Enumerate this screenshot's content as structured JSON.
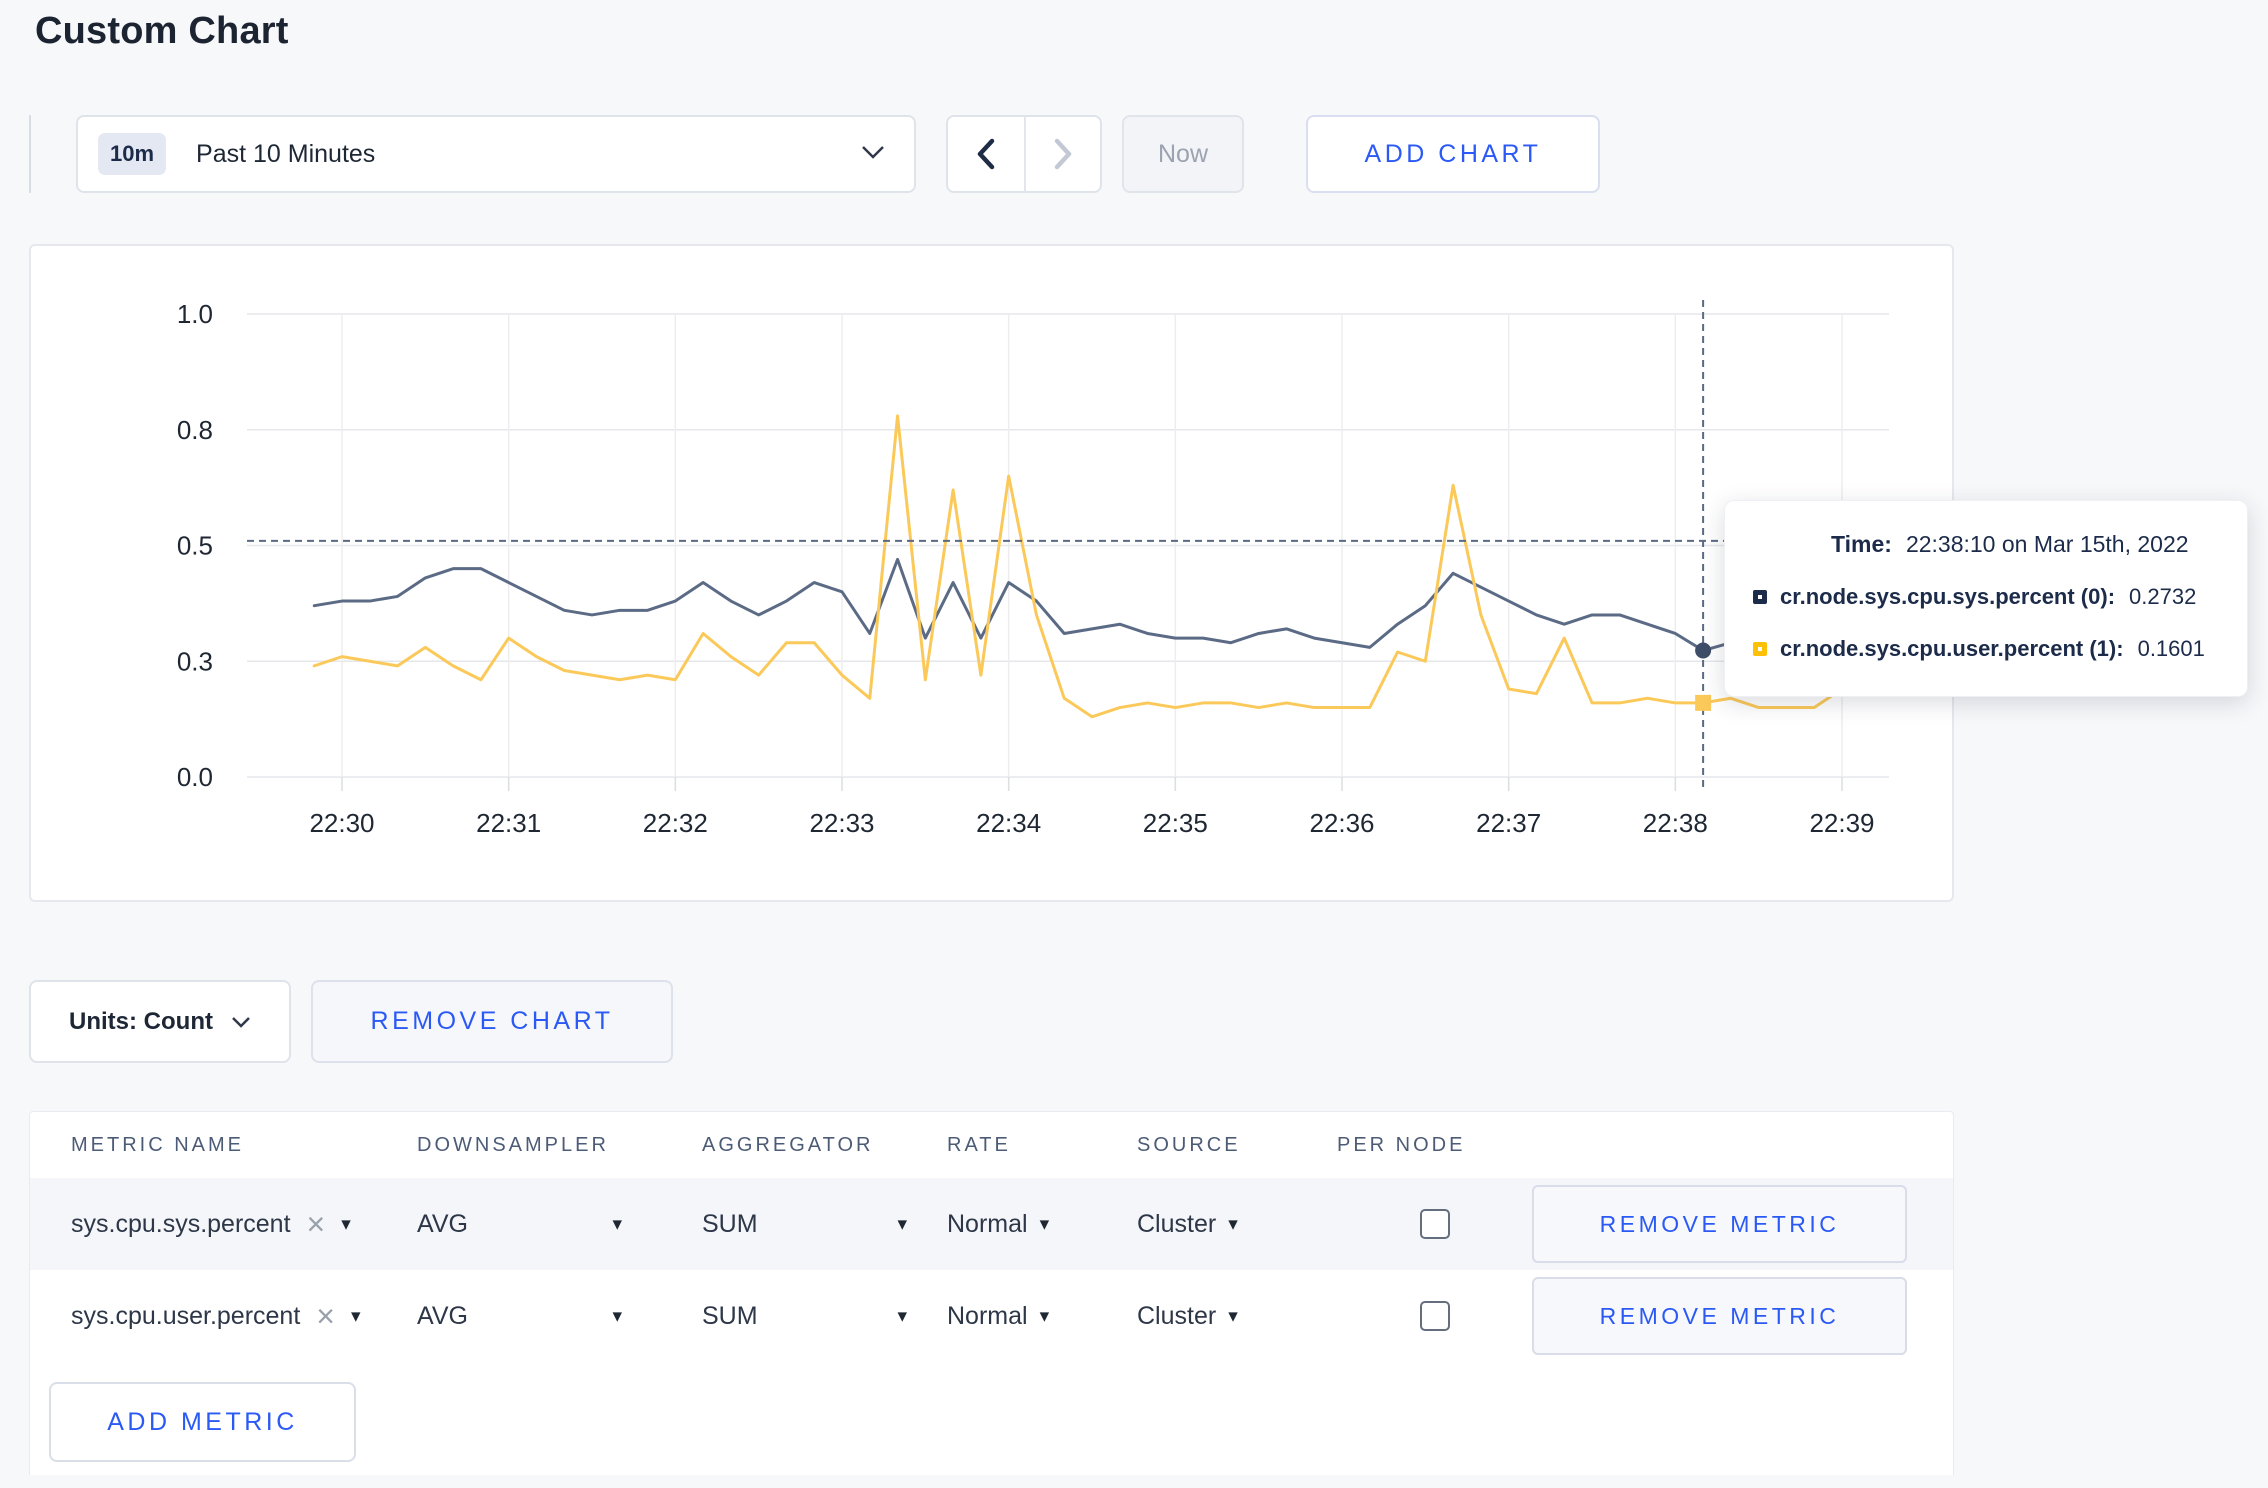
{
  "colors": {
    "accent": "#2b59f5",
    "navy": "#1c2b4a",
    "series-sys": "#5c6b85",
    "series-user": "#fbc959"
  },
  "page": {
    "title": "Custom Chart"
  },
  "toolbar": {
    "range_badge": "10m",
    "range_label": "Past 10 Minutes",
    "now_label": "Now",
    "add_chart_label": "ADD CHART"
  },
  "tooltip": {
    "time_label": "Time:",
    "time_value": "22:38:10 on Mar 15th, 2022",
    "series": [
      {
        "label": "cr.node.sys.cpu.sys.percent (0):",
        "value": "0.2732",
        "swatch": "#1c2b4a"
      },
      {
        "label": "cr.node.sys.cpu.user.percent (1):",
        "value": "0.1601",
        "swatch": "#ffc107"
      }
    ]
  },
  "chart_actions": {
    "units_label": "Units: Count",
    "remove_chart_label": "REMOVE CHART",
    "add_metric_label": "ADD METRIC"
  },
  "metrics_table": {
    "headers": [
      "METRIC NAME",
      "DOWNSAMPLER",
      "AGGREGATOR",
      "RATE",
      "SOURCE",
      "PER NODE"
    ],
    "rows": [
      {
        "name": "sys.cpu.sys.percent",
        "downsampler": "AVG",
        "aggregator": "SUM",
        "rate": "Normal",
        "source": "Cluster",
        "per_node_checked": false,
        "remove_label": "REMOVE METRIC"
      },
      {
        "name": "sys.cpu.user.percent",
        "downsampler": "AVG",
        "aggregator": "SUM",
        "rate": "Normal",
        "source": "Cluster",
        "per_node_checked": false,
        "remove_label": "REMOVE METRIC"
      }
    ]
  },
  "chart_data": {
    "type": "line",
    "title": "",
    "xlabel": "",
    "ylabel": "",
    "ylim": [
      0,
      1
    ],
    "grid": true,
    "legend": "none",
    "y_ticks": [
      {
        "label": "0.0",
        "v": 0
      },
      {
        "label": "0.3",
        "v": 0.25
      },
      {
        "label": "0.5",
        "v": 0.5
      },
      {
        "label": "0.8",
        "v": 0.75
      },
      {
        "label": "1.0",
        "v": 1
      }
    ],
    "x_ticks": [
      {
        "label": "22:30",
        "t": 0
      },
      {
        "label": "22:31",
        "t": 60
      },
      {
        "label": "22:32",
        "t": 120
      },
      {
        "label": "22:33",
        "t": 180
      },
      {
        "label": "22:34",
        "t": 240
      },
      {
        "label": "22:35",
        "t": 300
      },
      {
        "label": "22:36",
        "t": 360
      },
      {
        "label": "22:37",
        "t": 420
      },
      {
        "label": "22:38",
        "t": 480
      },
      {
        "label": "22:39",
        "t": 540
      }
    ],
    "x_start_s": -10,
    "x_step_s": 10,
    "series": [
      {
        "name": "cr.node.sys.cpu.sys.percent",
        "color": "#5c6b85",
        "values": [
          0.37,
          0.38,
          0.38,
          0.39,
          0.43,
          0.45,
          0.45,
          0.42,
          0.39,
          0.36,
          0.35,
          0.36,
          0.36,
          0.38,
          0.42,
          0.38,
          0.35,
          0.38,
          0.42,
          0.4,
          0.31,
          0.47,
          0.3,
          0.42,
          0.3,
          0.42,
          0.38,
          0.31,
          0.32,
          0.33,
          0.31,
          0.3,
          0.3,
          0.29,
          0.31,
          0.32,
          0.3,
          0.29,
          0.28,
          0.33,
          0.37,
          0.44,
          0.41,
          0.38,
          0.35,
          0.33,
          0.35,
          0.35,
          0.33,
          0.31,
          0.2732,
          0.29,
          0.28,
          0.29,
          0.31,
          0.3,
          0.31
        ]
      },
      {
        "name": "cr.node.sys.cpu.user.percent",
        "color": "#fbc959",
        "values": [
          0.24,
          0.26,
          0.25,
          0.24,
          0.28,
          0.24,
          0.21,
          0.3,
          0.26,
          0.23,
          0.22,
          0.21,
          0.22,
          0.21,
          0.31,
          0.26,
          0.22,
          0.29,
          0.29,
          0.22,
          0.17,
          0.78,
          0.21,
          0.62,
          0.22,
          0.65,
          0.35,
          0.17,
          0.13,
          0.15,
          0.16,
          0.15,
          0.16,
          0.16,
          0.15,
          0.16,
          0.15,
          0.15,
          0.15,
          0.27,
          0.25,
          0.63,
          0.35,
          0.19,
          0.18,
          0.3,
          0.16,
          0.16,
          0.17,
          0.16,
          0.1601,
          0.17,
          0.15,
          0.15,
          0.15,
          0.19,
          0.28
        ]
      }
    ],
    "crosshair": {
      "t": 490,
      "time_label": "22:38:10",
      "y_value": 0.51
    }
  }
}
